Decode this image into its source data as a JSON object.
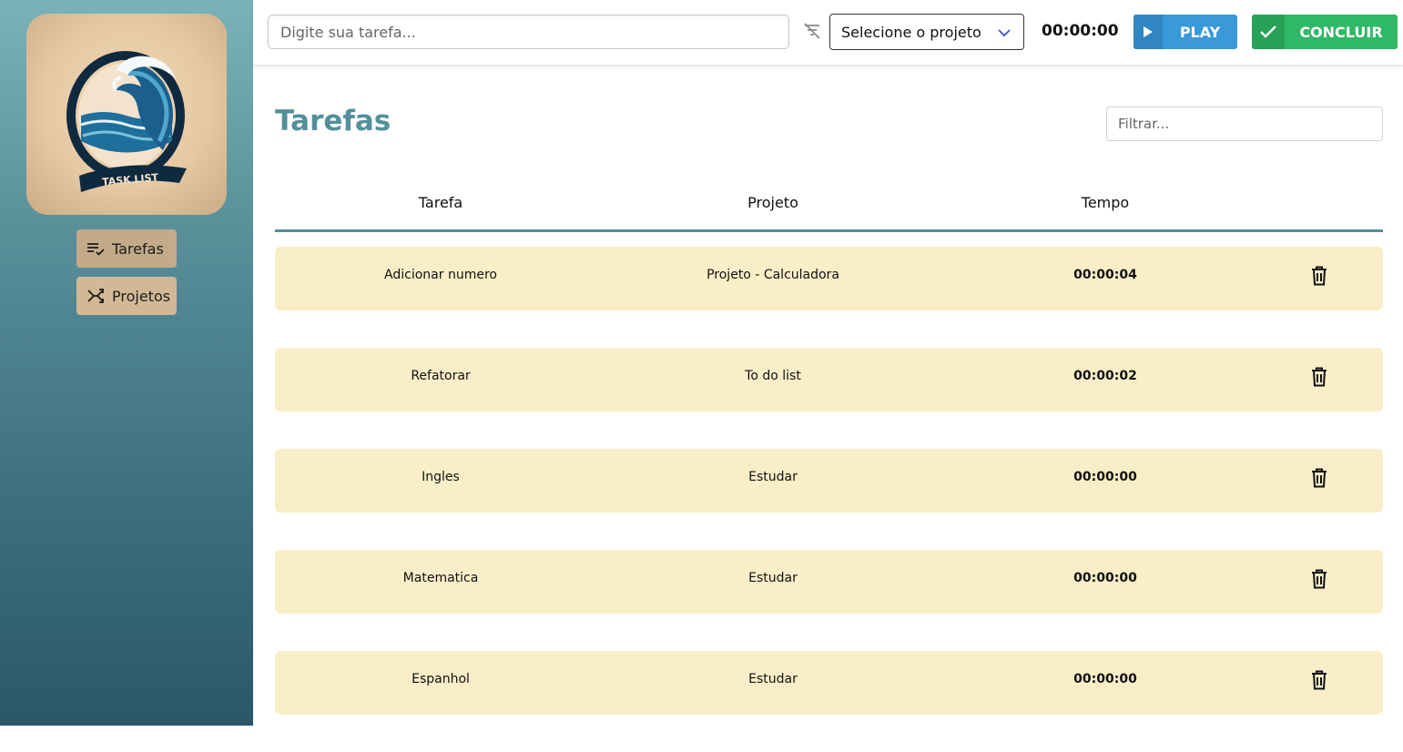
{
  "sidebar": {
    "logo": {
      "text": "TASK LIST",
      "icon": "wave-logo-icon"
    },
    "items": [
      {
        "label": "Tarefas",
        "icon": "list-check-icon",
        "active": true
      },
      {
        "label": "Projetos",
        "icon": "shuffle-icon",
        "active": false
      }
    ]
  },
  "topbar": {
    "task_placeholder": "Digite sua tarefa...",
    "task_value": "",
    "filter_icon": "filter-off-icon",
    "project_select": {
      "selected": "Selecione o projeto",
      "icon": "chevron-down-icon"
    },
    "timer": "00:00:00",
    "play_label": "PLAY",
    "done_label": "CONCLUIR"
  },
  "main": {
    "title": "Tarefas",
    "filter_placeholder": "Filtrar...",
    "columns": [
      "Tarefa",
      "Projeto",
      "Tempo"
    ],
    "rows": [
      {
        "task": "Adicionar numero",
        "project": "Projeto - Calculadora",
        "time": "00:00:04"
      },
      {
        "task": "Refatorar",
        "project": "To do list",
        "time": "00:00:02"
      },
      {
        "task": "Ingles",
        "project": "Estudar",
        "time": "00:00:00"
      },
      {
        "task": "Matematica",
        "project": "Estudar",
        "time": "00:00:00"
      },
      {
        "task": "Espanhol",
        "project": "Estudar",
        "time": "00:00:00"
      }
    ]
  },
  "colors": {
    "accent": "#53909a",
    "play": "#3a99d8",
    "done": "#2fb866",
    "row_bg": "#faeec8",
    "nav_bg": "#d2b996"
  }
}
